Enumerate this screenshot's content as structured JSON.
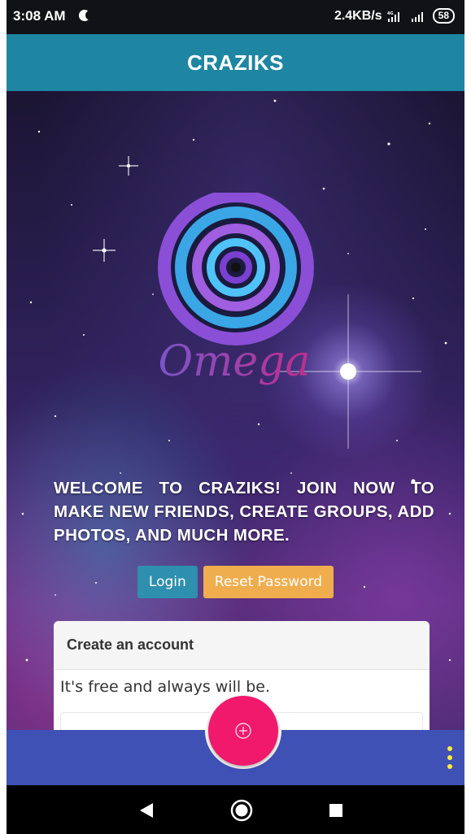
{
  "status_bar": {
    "time": "3:08 AM",
    "network_speed": "2.4KB/s",
    "battery": "58",
    "icons": [
      "moon-icon",
      "signal-4g-icon",
      "signal-icon",
      "battery-icon"
    ]
  },
  "app_bar": {
    "title": "CRAZIKS",
    "background": "#1e86a2"
  },
  "logo": {
    "text": "Omega"
  },
  "welcome_text": "WELCOME TO CRAZIKS! JOIN NOW TO MAKE NEW FRIENDS, CREATE GROUPS, ADD PHOTOS, AND MUCH MORE.",
  "buttons": {
    "login": "Login",
    "reset_password": "Reset Password"
  },
  "card": {
    "header": "Create an account",
    "subtitle": "It's free and always will be."
  },
  "bottom_bar": {
    "background": "#3f51b5",
    "fab_color": "#f0196c",
    "fab_icon": "add-circle-icon",
    "menu_icon": "more-vert-icon",
    "menu_color": "#ffeb3b"
  },
  "nav_bar": {
    "icons": [
      "back-icon",
      "home-icon",
      "recent-apps-icon"
    ]
  }
}
